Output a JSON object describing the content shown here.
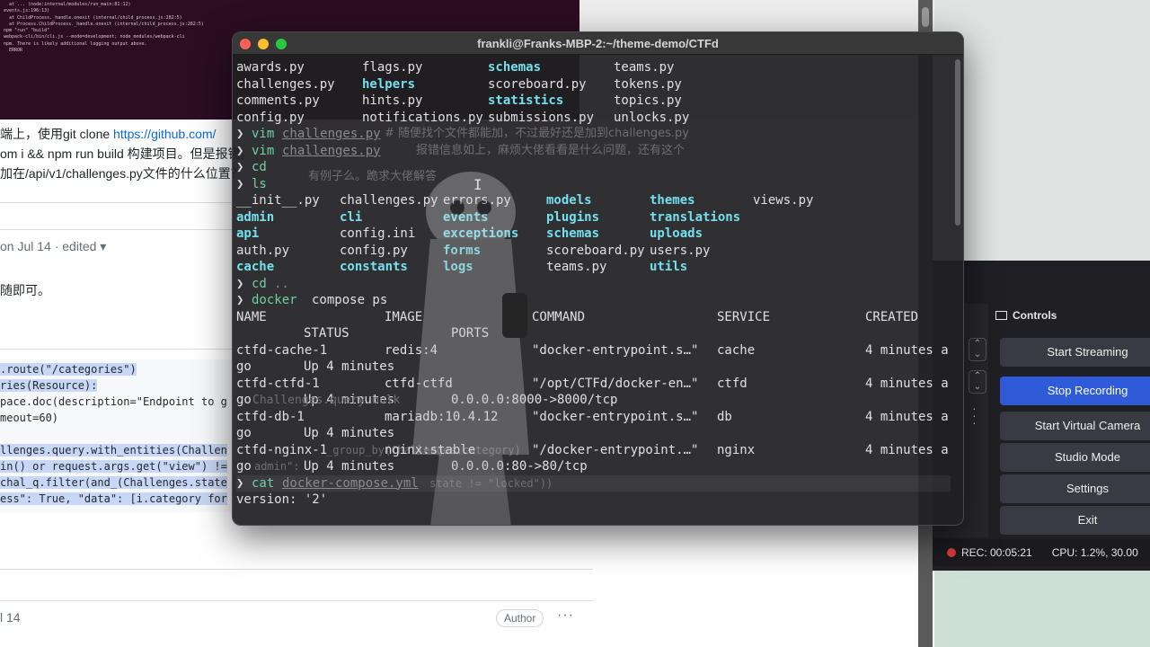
{
  "browser": {
    "bg_terminal_lines": [
      "  at ... (node:internal/modules/run_main:81:12)",
      "events.js:196:13)",
      "  at ChildProcess._handle.onexit (internal/child_process.js:282:5)",
      "  at Process.ChildProcess._handle.onexit (internal/child_process.js:282:5)",
      "",
      "",
      "npm \"run\" \"build\"",
      "",
      "",
      "webpack-cli/bin/cli.js --mode=development; node_modules/webpack-cli",
      "",
      "",
      "npm. There is likely additional logging output above.",
      "",
      "",
      "  ERROR"
    ],
    "post": {
      "line1_text": "端上，使用git clone ",
      "line1_link": "https://github.com/",
      "line2_text": "om i && npm run build 构建项目。但是报错。",
      "line3_text": "加在/api/v1/challenges.py文件的什么位置？"
    },
    "comment": {
      "meta": "on Jul 14 · edited ▾",
      "text": "随即可。"
    },
    "code_lines": [
      {
        "text": ".route(\"/categories\")",
        "hl": true
      },
      {
        "text": "ries(Resource):",
        "hl": true
      },
      {
        "text": "pace.doc(description=\"Endpoint to g",
        "hl": false
      },
      {
        "text": "meout=60)",
        "hl": false
      },
      {
        "text": "",
        "hl": false
      },
      {
        "text": "llenges.query.with_entities(Challen",
        "hl": true
      },
      {
        "text": "in() or request.args.get(\"view\") !=",
        "hl": true
      },
      {
        "text": "chal_q.filter(and_(Challenges.state",
        "hl": true
      },
      {
        "text": "ess\": True, \"data\": [i.category for",
        "hl": true
      }
    ],
    "second_date": "l 14",
    "author_badge": "Author",
    "kebab": "···"
  },
  "obs": {
    "controls_title": "Controls",
    "buttons": [
      {
        "label": "Start Streaming",
        "active": false
      },
      {
        "label": "Stop Recording",
        "active": true
      },
      {
        "label": "Start Virtual Camera",
        "active": false
      },
      {
        "label": "Studio Mode",
        "active": false
      },
      {
        "label": "Settings",
        "active": false
      },
      {
        "label": "Exit",
        "active": false
      }
    ],
    "rec_time": "REC: 00:05:21",
    "cpu": "CPU: 1.2%, 30.00"
  },
  "terminal": {
    "title": "frankli@Franks-MBP-2:~/theme-demo/CTFd",
    "ls_top": [
      [
        "awards.py",
        "flags.py",
        "schemas",
        "teams.py"
      ],
      [
        "challenges.py",
        "helpers",
        "scoreboard.py",
        "tokens.py"
      ],
      [
        "comments.py",
        "hints.py",
        "statistics",
        "topics.py"
      ],
      [
        "config.py",
        "notifications.py",
        "submissions.py",
        "unlocks.py"
      ]
    ],
    "cmd_vim_1": "vim",
    "arg_vim_1": "challenges.py",
    "overlay_1": "# 随便找个文件都能加，不过最好还是加到challenges.py",
    "cmd_vim_2": "vim",
    "arg_vim_2": "challenges.py",
    "overlay_2": "报错信息如上，麻烦大佬看看是什么问题，还有这个",
    "cmd_cd_1": "cd",
    "cmd_ls": "ls",
    "overlay_3": "有例子么。跪求大佬解答",
    "ls_bottom": [
      [
        "__init__.py",
        "challenges.py",
        "errors.py",
        "models",
        "themes",
        "views.py"
      ],
      [
        "admin",
        "cli",
        "events",
        "plugins",
        "translations",
        ""
      ],
      [
        "api",
        "config.ini",
        "exceptions",
        "schemas",
        "uploads",
        ""
      ],
      [
        "auth.py",
        "config.py",
        "forms",
        "scoreboard.py",
        "users.py",
        ""
      ],
      [
        "cache",
        "constants",
        "logs",
        "teams.py",
        "utils",
        ""
      ]
    ],
    "cmd_cd_2": "cd",
    "arg_cd_2": "..",
    "cmd_docker": "docker",
    "arg_docker": "compose ps",
    "ps_headers": [
      "NAME",
      "IMAGE",
      "COMMAND",
      "SERVICE",
      "CREATED"
    ],
    "ps_headers_2": [
      "STATUS",
      "PORTS"
    ],
    "ps_rows": [
      {
        "name": "ctfd-cache-1",
        "image": "redis:4",
        "command": "\"docker-entrypoint.s…\"",
        "service": "cache",
        "created": "4 minutes a",
        "cont": "go",
        "status": "Up 4 minutes",
        "ports": ""
      },
      {
        "name": "ctfd-ctfd-1",
        "image": "ctfd-ctfd",
        "command": "\"/opt/CTFd/docker-en…\"",
        "service": "ctfd",
        "created": "4 minutes a",
        "cont": "go",
        "status": "Up 4 minutes",
        "ports": "0.0.0.0:8000->8000/tcp"
      },
      {
        "name": "ctfd-db-1",
        "image": "mariadb:10.4.12",
        "command": "\"docker-entrypoint.s…\"",
        "service": "db",
        "created": "4 minutes a",
        "cont": "go",
        "status": "Up 4 minutes",
        "ports": ""
      },
      {
        "name": "ctfd-nginx-1",
        "image": "nginx:stable",
        "command": "\"/docker-entrypoint.…\"",
        "service": "nginx",
        "created": "4 minutes a",
        "cont": "go",
        "status": "Up 4 minutes",
        "ports": "0.0.0.0:80->80/tcp"
      }
    ],
    "cmd_cat": "cat",
    "arg_cat": "docker-compose.yml",
    "last_line": "version: '2'",
    "prompt_symbol": "❯",
    "ghost_code_1": "Challenges.query.bulk",
    "ghost_code_2": "_group_by(Challenges.category)",
    "ghost_code_3": "admin\":",
    "ghost_code_4": "state != \"locked\"))"
  },
  "colors": {
    "terminal_bg": "#202022",
    "dir": "#74e0ef",
    "cmd": "#6fd0a3",
    "obs_active": "#2f5bd8",
    "rec_dot": "#d73b3b"
  }
}
